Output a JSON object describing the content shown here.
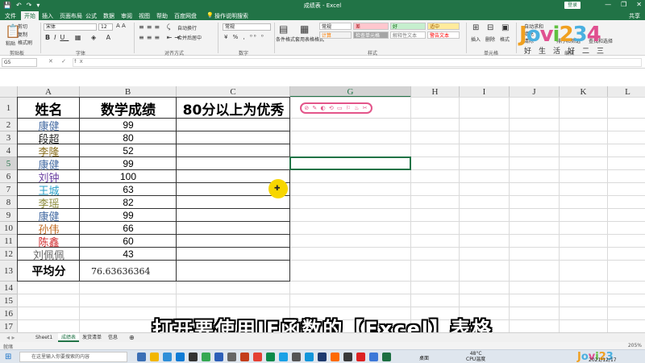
{
  "window": {
    "title": "成绩表 - Excel",
    "login_label": "登录",
    "controls": [
      "—",
      "❐",
      "✕"
    ],
    "qat": [
      "💾",
      "↶",
      "↷",
      "▾"
    ]
  },
  "ribbon_tabs": [
    "文件",
    "开始",
    "插入",
    "页面布局",
    "公式",
    "数据",
    "审阅",
    "视图",
    "帮助",
    "百度网盘",
    "操作说明搜索"
  ],
  "active_tab": "开始",
  "share_label": "共享",
  "ribbon": {
    "paste": "粘贴",
    "cut": "剪切",
    "copy": "复制",
    "format_painter": "格式刷",
    "clipboard": "剪贴板",
    "font_name": "宋体",
    "font_size": "12",
    "font_group": "字体",
    "wrap": "自动换行",
    "merge": "合并后居中",
    "align_group": "对齐方式",
    "number_format": "常规",
    "number_group": "数字",
    "cond_format": "条件格式",
    "table_format": "套用表格格式",
    "styles_group": "样式",
    "styles": [
      {
        "label": "常规",
        "bg": "#ffffff",
        "color": "#222222"
      },
      {
        "label": "差",
        "bg": "#ffc7ce",
        "color": "#9c0006"
      },
      {
        "label": "好",
        "bg": "#c6efce",
        "color": "#006100"
      },
      {
        "label": "适中",
        "bg": "#ffeb9c",
        "color": "#9c5700"
      },
      {
        "label": "计算",
        "bg": "#f2f2f2",
        "color": "#fa7d00"
      },
      {
        "label": "检查单元格",
        "bg": "#a5a5a5",
        "color": "#ffffff"
      },
      {
        "label": "解释性文本",
        "bg": "#ffffff",
        "color": "#7f7f7f"
      },
      {
        "label": "警告文本",
        "bg": "#ffffff",
        "color": "#ff0000"
      }
    ],
    "insert": "插入",
    "delete": "删除",
    "format": "格式",
    "cells_group": "单元格",
    "autosum": "自动求和",
    "fill": "填充",
    "clear": "清除",
    "sort_filter": "排序和筛选",
    "find": "查找和选择",
    "editing_group": "编辑"
  },
  "formula_bar": {
    "name_box": "G5",
    "fx_icons": "✕ ✓ fx",
    "value": ""
  },
  "columns": [
    "A",
    "B",
    "C",
    "G",
    "H",
    "I",
    "J",
    "K",
    "L"
  ],
  "selected_column": "G",
  "rows": [
    "1",
    "2",
    "3",
    "4",
    "5",
    "6",
    "7",
    "8",
    "9",
    "10",
    "11",
    "12",
    "13",
    "14",
    "15",
    "16",
    "17"
  ],
  "selected_row": "5",
  "headers": {
    "name": "姓名",
    "score": "数学成绩",
    "excellent": "80分以上为优秀"
  },
  "records": [
    {
      "name": "康健",
      "score": "99",
      "color": "#4a6fa5"
    },
    {
      "name": "段超",
      "score": "80",
      "color": "#222222"
    },
    {
      "name": "李隆",
      "score": "52",
      "color": "#8b6f1e"
    },
    {
      "name": "康健",
      "score": "99",
      "color": "#4a6fa5"
    },
    {
      "name": "刘钟",
      "score": "100",
      "color": "#6a3fa0"
    },
    {
      "name": "王城",
      "score": "63",
      "color": "#2aa0c8"
    },
    {
      "name": "李瑶",
      "score": "82",
      "color": "#8b8a3a"
    },
    {
      "name": "康健",
      "score": "99",
      "color": "#4a6fa5"
    },
    {
      "name": "孙伟",
      "score": "66",
      "color": "#c06a20"
    },
    {
      "name": "陈鑫",
      "score": "60",
      "color": "#d0282b"
    },
    {
      "name": "刘佩佩",
      "score": "43",
      "color": "#666666"
    }
  ],
  "average": {
    "label": "平均分",
    "value": "76.63636364"
  },
  "sheet_tabs": [
    "Sheet1",
    "成绩表",
    "发货清单",
    "信息"
  ],
  "active_sheet": "成绩表",
  "status_text": "就绪",
  "zoom": "205%",
  "taskbar": {
    "search_placeholder": "在这里输入你要搜索的内容",
    "desktop": "桌面",
    "weather": "48°C",
    "weather_sub": "CPU温度",
    "time": "2021/12/17"
  },
  "subtitle": "打开要使用IF函数的【Excel】表格",
  "logo": {
    "text": "Jovi234",
    "sub": "好生活好二三"
  }
}
